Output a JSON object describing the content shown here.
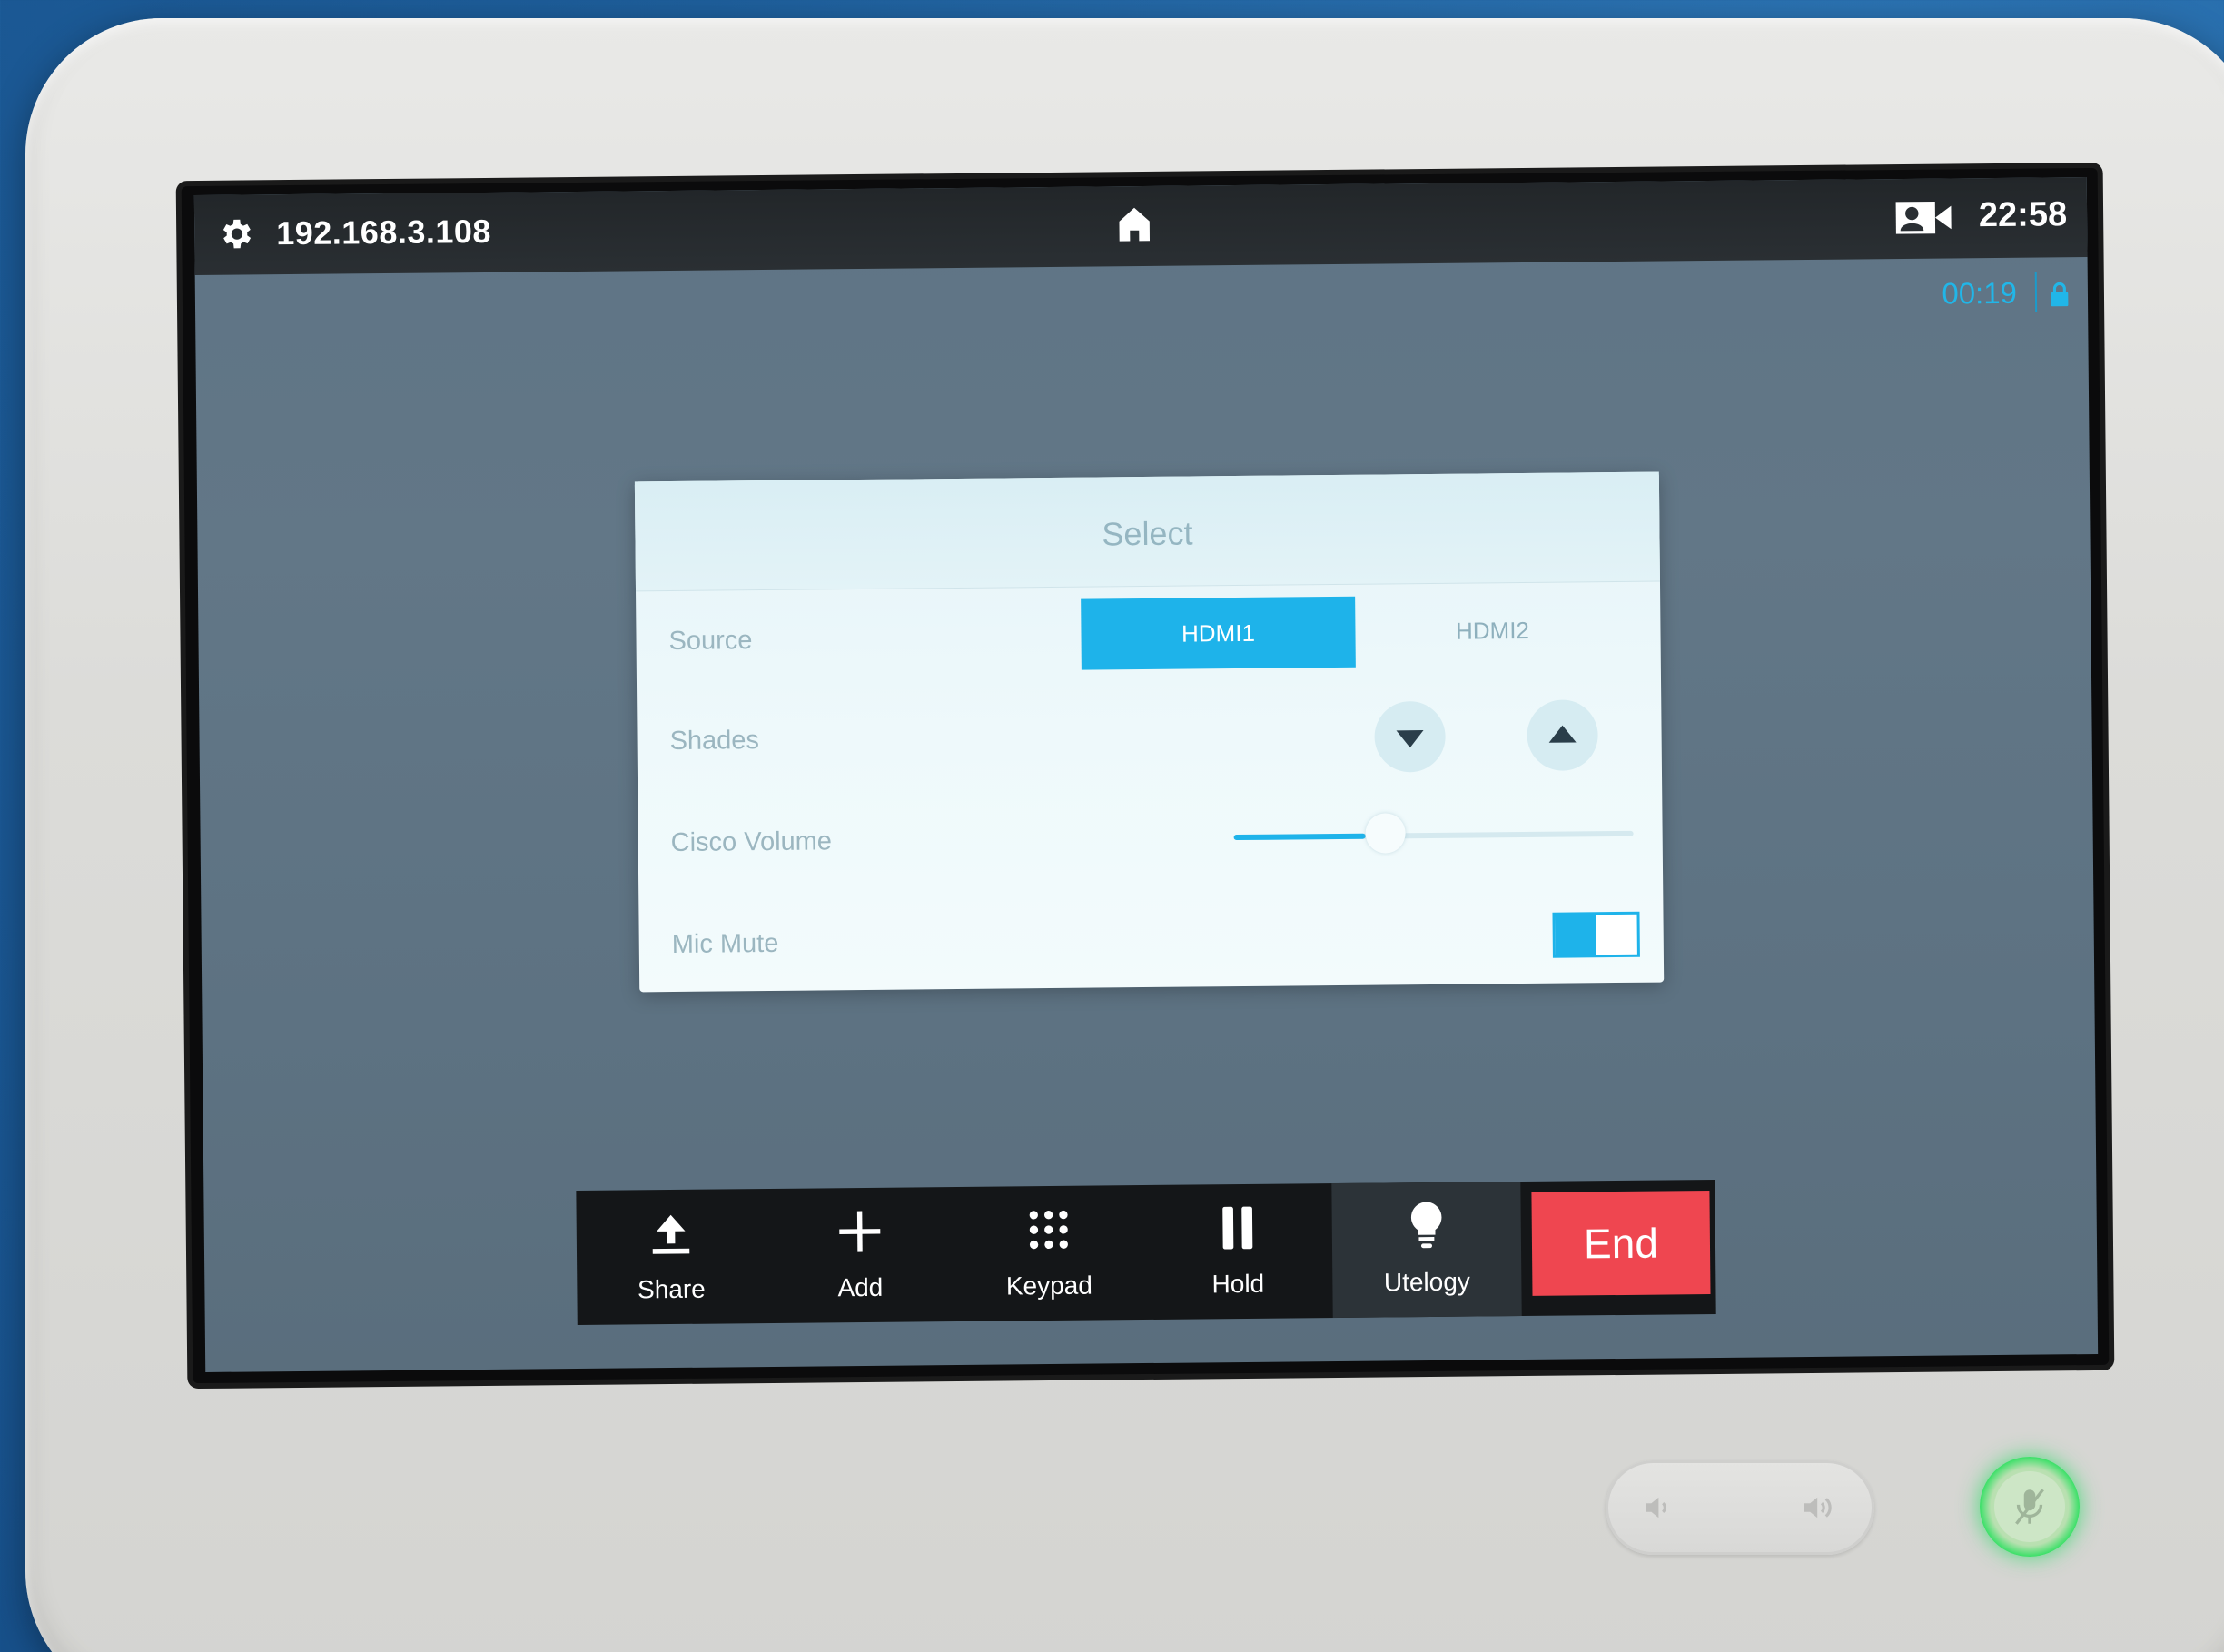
{
  "status_bar": {
    "ip_address": "192.168.3.108",
    "clock": "22:58",
    "call_duration": "00:19",
    "icons": [
      "gear-icon",
      "home-icon",
      "camera-icon",
      "lock-icon"
    ]
  },
  "panel": {
    "title": "Select",
    "rows": {
      "source": {
        "label": "Source",
        "options": [
          "HDMI1",
          "HDMI2"
        ],
        "selected": "HDMI1"
      },
      "shades": {
        "label": "Shades",
        "buttons": [
          "arrow-down-icon",
          "arrow-up-icon"
        ]
      },
      "volume": {
        "label": "Cisco Volume",
        "level": 0.38
      },
      "mic_mute": {
        "label": "Mic Mute",
        "on": true
      }
    }
  },
  "call_bar": {
    "buttons": [
      {
        "label": "Share",
        "icon": "share-upload-icon"
      },
      {
        "label": "Add",
        "icon": "plus-icon"
      },
      {
        "label": "Keypad",
        "icon": "keypad-icon"
      },
      {
        "label": "Hold",
        "icon": "pause-icon"
      },
      {
        "label": "Utelogy",
        "icon": "lightbulb-icon"
      }
    ],
    "end_label": "End"
  },
  "colors": {
    "accent": "#1eb3ea",
    "end": "#ef4650",
    "mic_led": "#22d95a"
  }
}
